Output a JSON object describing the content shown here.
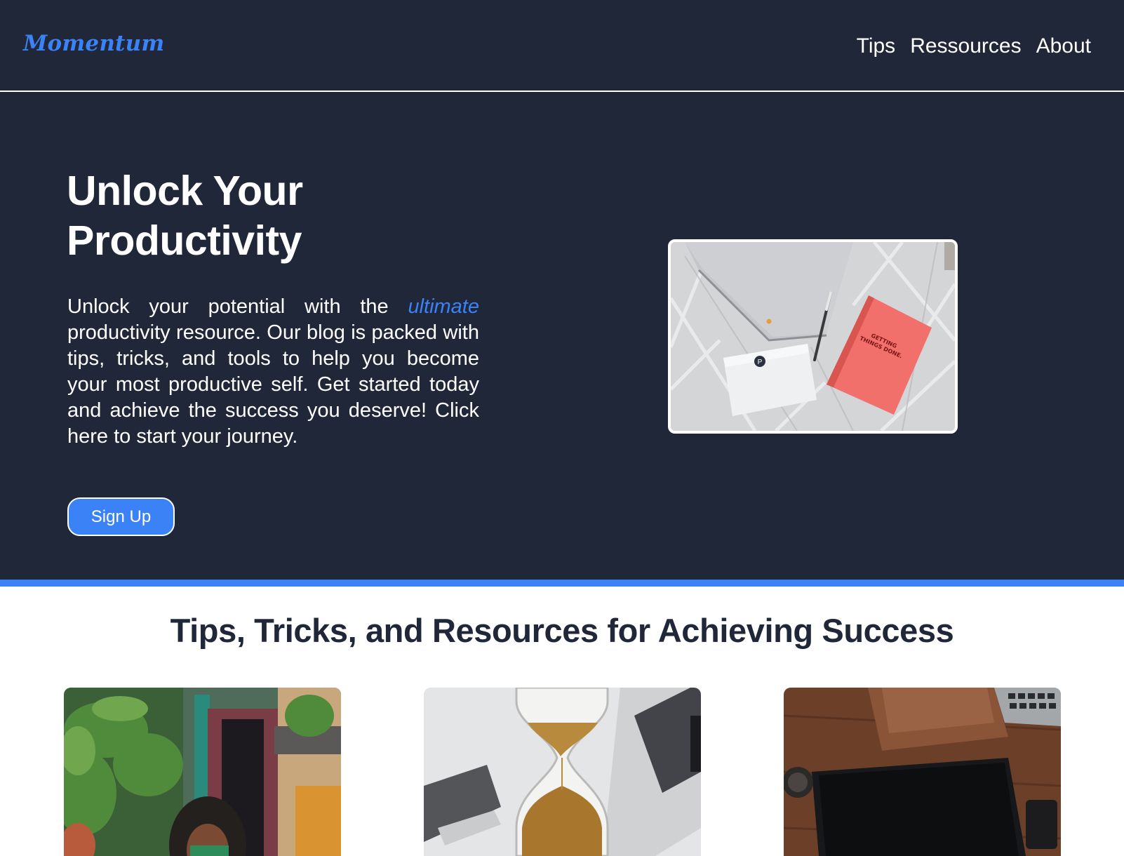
{
  "header": {
    "brand": "Momentum",
    "nav": [
      {
        "label": "Tips"
      },
      {
        "label": "Ressources"
      },
      {
        "label": "About"
      }
    ]
  },
  "hero": {
    "title_line1": "Unlock Your",
    "title_line2": "Productivity",
    "text_before": "Unlock your potential with the ",
    "text_accent": "ultimate",
    "text_after": " productivity resource. Our blog is packed with tips, tricks, and tools to help you become your most productive self. Get started today and achieve the success you deserve! Click here to start your journey.",
    "signup_label": "Sign Up",
    "image_book_text_1": "GETTING",
    "image_book_text_2": "THINGS DONE.",
    "image_badge_letter": "P"
  },
  "tips": {
    "title": "Tips, Tricks, and Resources for Achieving Success"
  },
  "colors": {
    "navy": "#1f2738",
    "accent_blue": "#3b82f6",
    "white": "#ffffff"
  }
}
